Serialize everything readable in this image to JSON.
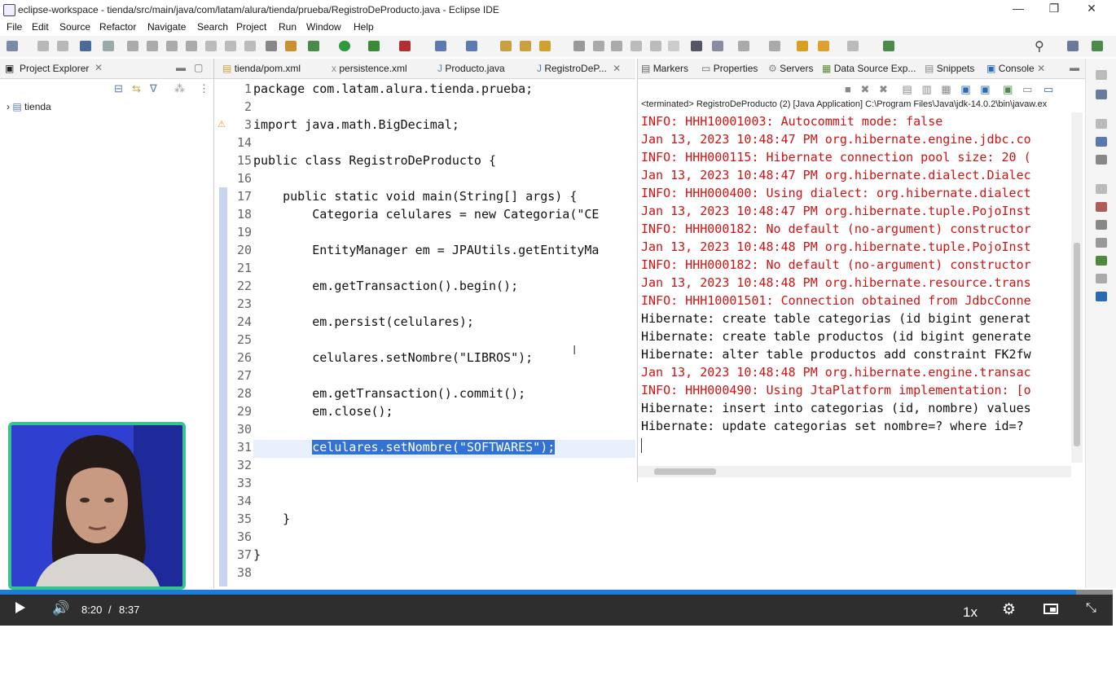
{
  "window": {
    "title": "eclipse-workspace - tienda/src/main/java/com/latam/alura/tienda/prueba/RegistroDeProducto.java - Eclipse IDE",
    "minimize": "—",
    "restore": "❐",
    "close": "✕"
  },
  "menu": [
    "File",
    "Edit",
    "Source",
    "Refactor",
    "Navigate",
    "Search",
    "Project",
    "Run",
    "Window",
    "Help"
  ],
  "project_explorer": {
    "tab_label": "Project Explorer",
    "tree": [
      {
        "label": "tienda",
        "expanded": false
      }
    ]
  },
  "editor": {
    "tabs": [
      {
        "label": "tienda/pom.xml",
        "icon": "xml-file-icon"
      },
      {
        "label": "persistence.xml",
        "icon": "xml-file-icon"
      },
      {
        "label": "Producto.java",
        "icon": "java-file-icon"
      },
      {
        "label": "RegistroDeP...",
        "icon": "java-file-icon",
        "active": true
      }
    ],
    "lines": [
      {
        "n": "1",
        "text": "package com.latam.alura.tienda.prueba;"
      },
      {
        "n": "2",
        "text": ""
      },
      {
        "n": "3",
        "text": "import java.math.BigDecimal;"
      },
      {
        "n": "14",
        "text": ""
      },
      {
        "n": "15",
        "text": "public class RegistroDeProducto {"
      },
      {
        "n": "16",
        "text": ""
      },
      {
        "n": "17",
        "text": "    public static void main(String[] args) {"
      },
      {
        "n": "18",
        "text": "        Categoria celulares = new Categoria(\"CE"
      },
      {
        "n": "19",
        "text": ""
      },
      {
        "n": "20",
        "text": "        EntityManager em = JPAUtils.getEntityMa"
      },
      {
        "n": "21",
        "text": ""
      },
      {
        "n": "22",
        "text": "        em.getTransaction().begin();"
      },
      {
        "n": "23",
        "text": ""
      },
      {
        "n": "24",
        "text": "        em.persist(celulares);"
      },
      {
        "n": "25",
        "text": ""
      },
      {
        "n": "26",
        "text": "        celulares.setNombre(\"LIBROS\");"
      },
      {
        "n": "27",
        "text": ""
      },
      {
        "n": "28",
        "text": "        em.getTransaction().commit();"
      },
      {
        "n": "29",
        "text": "        em.close();"
      },
      {
        "n": "30",
        "text": ""
      },
      {
        "n": "31",
        "text": "        celulares.setNombre(\"SOFTWARES\");"
      },
      {
        "n": "32",
        "text": ""
      },
      {
        "n": "33",
        "text": ""
      },
      {
        "n": "34",
        "text": ""
      },
      {
        "n": "35",
        "text": "    }"
      },
      {
        "n": "36",
        "text": ""
      },
      {
        "n": "37",
        "text": "}"
      },
      {
        "n": "38",
        "text": ""
      }
    ],
    "selected_text": "celulares.setNombre(\"SOFTWARES\");"
  },
  "console_view": {
    "tabs": [
      "Markers",
      "Properties",
      "Servers",
      "Data Source Exp...",
      "Snippets",
      "Console"
    ],
    "terminated_label": "<terminated> RegistroDeProducto (2) [Java Application] C:\\Program Files\\Java\\jdk-14.0.2\\bin\\javaw.ex",
    "lines": [
      {
        "text": "INFO: HHH10001003: Autocommit mode: false",
        "color": "red"
      },
      {
        "text": "Jan 13, 2023 10:48:47 PM org.hibernate.engine.jdbc.co",
        "color": "red"
      },
      {
        "text": "INFO: HHH000115: Hibernate connection pool size: 20 (",
        "color": "red"
      },
      {
        "text": "Jan 13, 2023 10:48:47 PM org.hibernate.dialect.Dialec",
        "color": "red"
      },
      {
        "text": "INFO: HHH000400: Using dialect: org.hibernate.dialect",
        "color": "red"
      },
      {
        "text": "Jan 13, 2023 10:48:47 PM org.hibernate.tuple.PojoInst",
        "color": "red"
      },
      {
        "text": "INFO: HHH000182: No default (no-argument) constructor",
        "color": "red"
      },
      {
        "text": "Jan 13, 2023 10:48:48 PM org.hibernate.tuple.PojoInst",
        "color": "red"
      },
      {
        "text": "INFO: HHH000182: No default (no-argument) constructor",
        "color": "red"
      },
      {
        "text": "Jan 13, 2023 10:48:48 PM org.hibernate.resource.trans",
        "color": "red"
      },
      {
        "text": "INFO: HHH10001501: Connection obtained from JdbcConne",
        "color": "red"
      },
      {
        "text": "Hibernate: create table categorias (id bigint generat",
        "color": "black"
      },
      {
        "text": "Hibernate: create table productos (id bigint generate",
        "color": "black"
      },
      {
        "text": "Hibernate: alter table productos add constraint FK2fw",
        "color": "black"
      },
      {
        "text": "Jan 13, 2023 10:48:48 PM org.hibernate.engine.transac",
        "color": "red"
      },
      {
        "text": "INFO: HHH000490: Using JtaPlatform implementation: [o",
        "color": "red"
      },
      {
        "text": "Hibernate: insert into categorias (id, nombre) values",
        "color": "black"
      },
      {
        "text": "Hibernate: update categorias set nombre=? where id=?",
        "color": "black"
      }
    ]
  },
  "player": {
    "current_time": "8:20",
    "separator": "/",
    "duration": "8:37",
    "progress_fraction": 0.9671,
    "speed": "1x"
  },
  "colors": {
    "accent": "#1e7bd6",
    "console_error": "#d01212",
    "keyword": "#7f0055",
    "selection": "#3172d4",
    "webcam_border": "#34c48c"
  }
}
